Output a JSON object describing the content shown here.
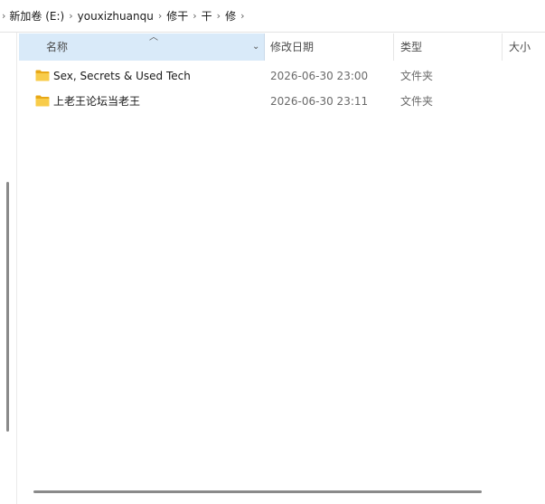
{
  "breadcrumb": [
    {
      "label": "新加卷 (E:)"
    },
    {
      "label": "youxizhuanqu"
    },
    {
      "label": "修干"
    },
    {
      "label": "干"
    },
    {
      "label": "修"
    }
  ],
  "columns": {
    "name": "名称",
    "date_modified": "修改日期",
    "type": "类型",
    "size": "大小"
  },
  "sort": {
    "column": "name",
    "direction": "ascending",
    "icon": "chevron-up-icon"
  },
  "files": [
    {
      "name": "Sex, Secrets & Used Tech",
      "date_modified": "2026-06-30 23:00",
      "type": "文件夹",
      "icon": "folder-icon"
    },
    {
      "name": "上老王论坛当老王",
      "date_modified": "2026-06-30 23:11",
      "type": "文件夹",
      "icon": "folder-icon"
    }
  ],
  "colors": {
    "header_selected_bg": "#d9eaf9",
    "folder_yellow": "#f5c542",
    "secondary_text": "#6a6a6a"
  }
}
